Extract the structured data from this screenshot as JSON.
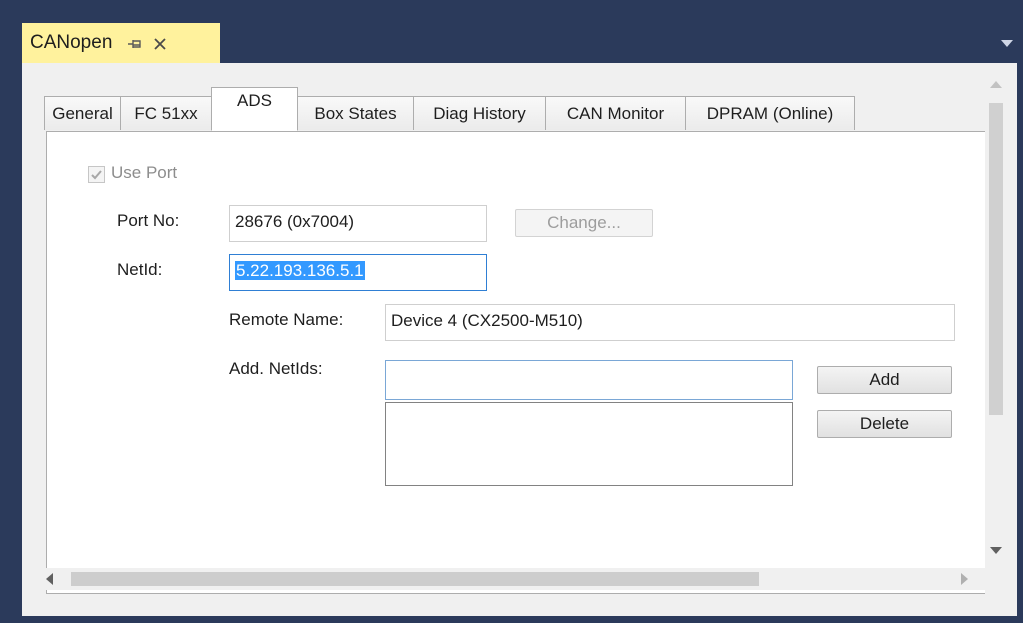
{
  "window": {
    "title": "CANopen",
    "pin_icon": "pin-icon",
    "close_icon": "close-icon",
    "menu_icon": "chevron-down-icon"
  },
  "tabs": [
    {
      "label": "General"
    },
    {
      "label": "FC 51xx"
    },
    {
      "label": "ADS"
    },
    {
      "label": "Box States"
    },
    {
      "label": "Diag History"
    },
    {
      "label": "CAN Monitor"
    },
    {
      "label": "DPRAM (Online)"
    }
  ],
  "active_tab": "ADS",
  "ads": {
    "use_port_label": "Use Port",
    "use_port_checked": true,
    "port_no_label": "Port No:",
    "port_no_value": "28676 (0x7004)",
    "change_label": "Change...",
    "netid_label": "NetId:",
    "netid_value": "5.22.193.136.5.1",
    "remote_name_label": "Remote Name:",
    "remote_name_value": "Device 4 (CX2500-M510)",
    "add_netids_label": "Add. NetIds:",
    "add_netids_value": "",
    "add_label": "Add",
    "delete_label": "Delete"
  },
  "colors": {
    "title_tab_bg": "#fff29d",
    "frame_bg": "#2b3a5b",
    "selection": "#3399ff"
  }
}
